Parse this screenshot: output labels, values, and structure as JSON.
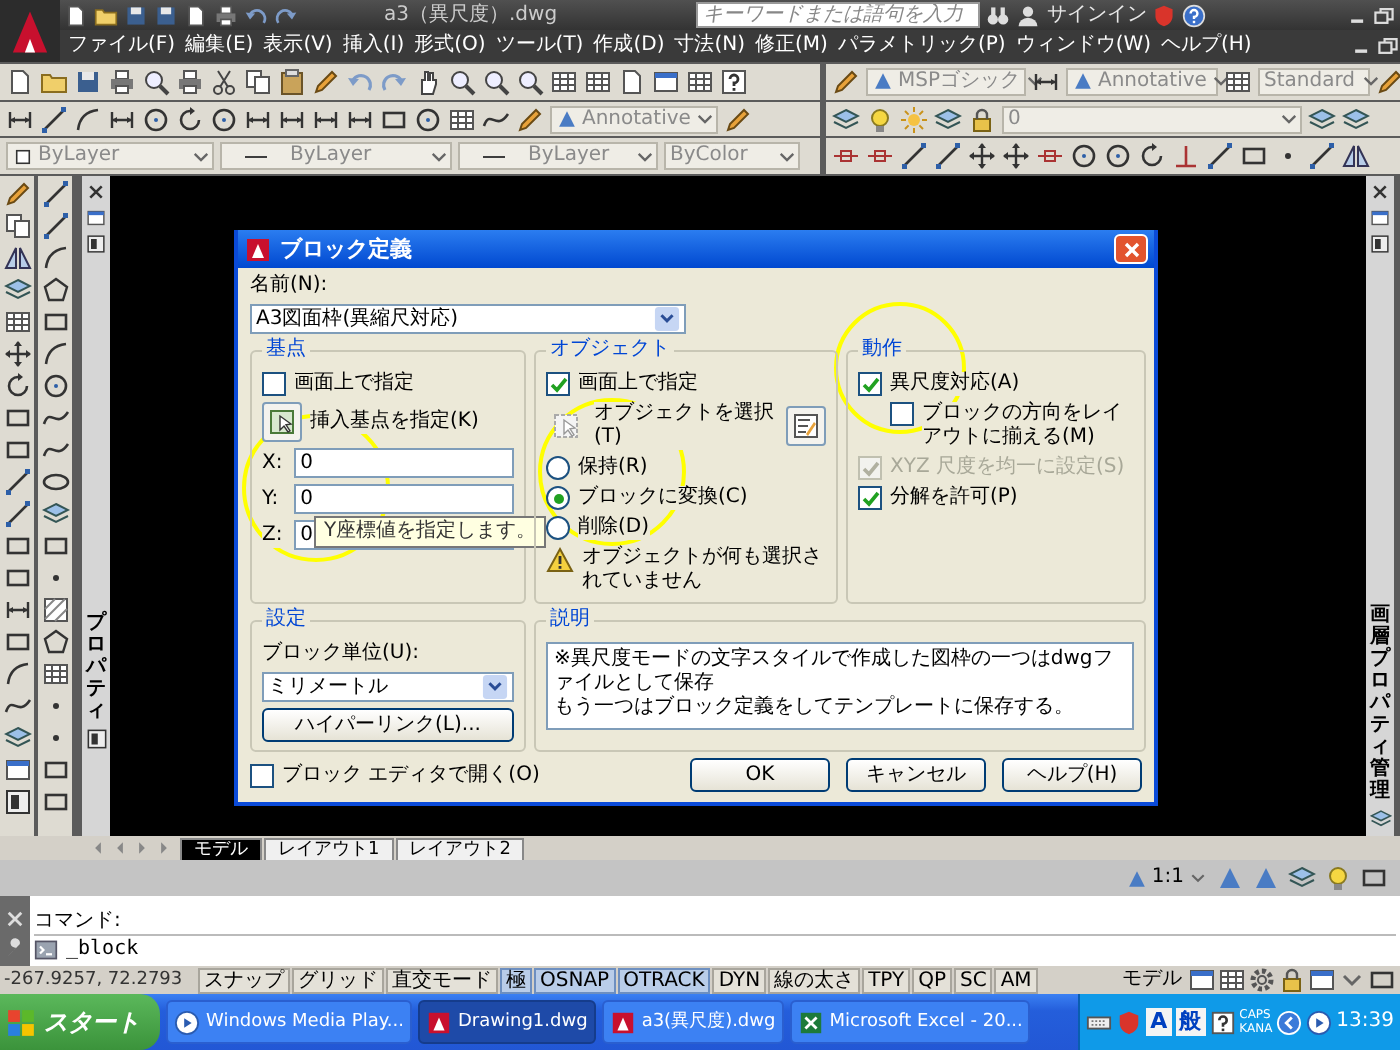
{
  "title_bar": {
    "title": "a3（異尺度）.dwg",
    "search": {
      "placeholder": "キーワードまたは語句を入力"
    },
    "sign_in": "サインイン"
  },
  "menu_bar": [
    "ファイル(F)",
    "編集(E)",
    "表示(V)",
    "挿入(I)",
    "形式(O)",
    "ツール(T)",
    "作成(D)",
    "寸法(N)",
    "修正(M)",
    "パラメトリック(P)",
    "ウィンドウ(W)",
    "ヘルプ(H)"
  ],
  "toolbars": {
    "text_style": "MSPゴシック",
    "dimension_style": "Annotative",
    "table_style": "Standard",
    "multileader_style": "Annotative",
    "layer": "0",
    "layer_color": "ByLayer",
    "linetype": "ByLayer",
    "lineweight": "ByLayer",
    "plot_style": "ByColor"
  },
  "left_palette": {
    "title": "プロパティ"
  },
  "right_palette": {
    "title": "画層プロパティ管理"
  },
  "dialog": {
    "title": "ブロック定義",
    "name_label": "名前(N):",
    "name_value": "A3図面枠(異縮尺対応)",
    "base_point": {
      "title": "基点",
      "specify_on_screen": {
        "label": "画面上で指定",
        "checked": false
      },
      "pick_label": "挿入基点を指定(K)",
      "coords": [
        {
          "label": "X:",
          "value": "0"
        },
        {
          "label": "Y:",
          "value": "0"
        },
        {
          "label": "Z:",
          "value": "0"
        }
      ],
      "tooltip": "Y座標値を指定します。"
    },
    "objects": {
      "title": "オブジェクト",
      "specify_on_screen": {
        "label": "画面上で指定",
        "checked": true
      },
      "select_label": "オブジェクトを選択(T)",
      "options": [
        {
          "label": "保持(R)",
          "selected": false
        },
        {
          "label": "ブロックに変換(C)",
          "selected": true
        },
        {
          "label": "削除(D)",
          "selected": false
        }
      ],
      "warning": "オブジェクトが何も選択されていません"
    },
    "behavior": {
      "title": "動作",
      "options": [
        {
          "label": "異尺度対応(A)",
          "checked": true,
          "disabled": false,
          "children": [
            {
              "label": "ブロックの方向をレイアウトに揃える(M)",
              "checked": false,
              "disabled": false
            }
          ]
        },
        {
          "label": "XYZ 尺度を均一に設定(S)",
          "checked": true,
          "disabled": true
        },
        {
          "label": "分解を許可(P)",
          "checked": true,
          "disabled": false
        }
      ]
    },
    "settings": {
      "title": "設定",
      "unit_label": "ブロック単位(U):",
      "unit_value": "ミリメートル",
      "hyperlink_button": "ハイパーリンク(L)..."
    },
    "description": {
      "title": "説明",
      "lines": [
        "※異尺度モードの文字スタイルで作成した図枠の一つはdwgファイルとして保存",
        "もう一つはブロック定義をしてテンプレートに保存する。"
      ]
    },
    "open_in_editor": {
      "label": "ブロック エディタで開く(O)",
      "checked": false
    },
    "buttons": [
      "OK",
      "キャンセル",
      "ヘルプ(H)"
    ]
  },
  "layout_tabs": [
    {
      "label": "モデル",
      "selected": true
    },
    {
      "label": "レイアウト1",
      "selected": false
    },
    {
      "label": "レイアウト2",
      "selected": false
    }
  ],
  "annotation_scale": "1:1",
  "command_line": {
    "history": "コマンド:",
    "input": "_block"
  },
  "status_bar": {
    "coordinates": "-267.9257, 72.2793",
    "toggles": [
      {
        "label": "スナップ",
        "on": false
      },
      {
        "label": "グリッド",
        "on": false
      },
      {
        "label": "直交モード",
        "on": false
      },
      {
        "label": "極",
        "on": true
      },
      {
        "label": "OSNAP",
        "on": true
      },
      {
        "label": "OTRACK",
        "on": true
      },
      {
        "label": "DYN",
        "on": false
      },
      {
        "label": "線の太さ",
        "on": false
      },
      {
        "label": "TPY",
        "on": false
      },
      {
        "label": "QP",
        "on": false
      },
      {
        "label": "SC",
        "on": false
      },
      {
        "label": "AM",
        "on": false
      }
    ],
    "space": "モデル"
  },
  "taskbar": {
    "start": "スタート",
    "tasks": [
      {
        "label": "Windows Media Play...",
        "kind": "media",
        "selected": false
      },
      {
        "label": "Drawing1.dwg",
        "kind": "drawing",
        "selected": true
      },
      {
        "label": "a3(異尺度).dwg",
        "kind": "drawing",
        "selected": false
      },
      {
        "label": "Microsoft Excel - 20...",
        "kind": "spreadsheet",
        "selected": false
      }
    ],
    "ime_input": "A",
    "ime_mode": "般",
    "caps": "CAPS",
    "kana": "KANA",
    "clock": "13:39"
  }
}
